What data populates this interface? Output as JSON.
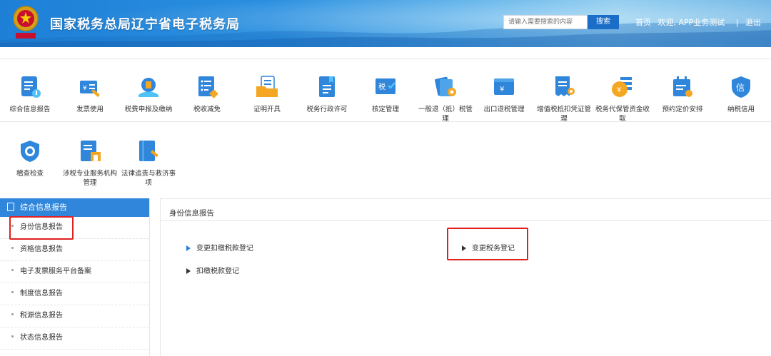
{
  "header": {
    "title": "国家税务总局辽宁省电子税务局",
    "search_placeholder": "请输入需要搜索的内容",
    "search_button": "搜索",
    "home": "首页",
    "welcome": "欢迎, APP业务测试",
    "separator": "|",
    "logout": "退出"
  },
  "menu": {
    "row1": [
      {
        "label": "综合信息报告",
        "icon": "report-icon"
      },
      {
        "label": "发票使用",
        "icon": "invoice-icon"
      },
      {
        "label": "税费申报及缴纳",
        "icon": "tax-declare-icon"
      },
      {
        "label": "税收减免",
        "icon": "tax-relief-icon"
      },
      {
        "label": "证明开具",
        "icon": "certificate-icon"
      },
      {
        "label": "税务行政许可",
        "icon": "permit-icon"
      },
      {
        "label": "核定管理",
        "icon": "approval-icon"
      },
      {
        "label": "一般退（抵）税管理",
        "icon": "refund-icon"
      },
      {
        "label": "出口退税管理",
        "icon": "export-refund-icon"
      },
      {
        "label": "增值税抵扣凭证管理",
        "icon": "vat-voucher-icon"
      },
      {
        "label": "税务代保管资金收取",
        "icon": "custody-fund-icon"
      },
      {
        "label": "预约定价安排",
        "icon": "pricing-calendar-icon"
      },
      {
        "label": "纳税信用",
        "icon": "credit-shield-icon"
      }
    ],
    "row2": [
      {
        "label": "稽查检查",
        "icon": "inspection-shield-icon"
      },
      {
        "label": "涉税专业服务机构管理",
        "icon": "agency-icon"
      },
      {
        "label": "法律追责与救济事项",
        "icon": "law-book-icon"
      }
    ]
  },
  "sidebar": {
    "header": "综合信息报告",
    "items": [
      {
        "label": "身份信息报告"
      },
      {
        "label": "资格信息报告"
      },
      {
        "label": "电子发票服务平台备案"
      },
      {
        "label": "制度信息报告"
      },
      {
        "label": "税源信息报告"
      },
      {
        "label": "状态信息报告"
      }
    ]
  },
  "content": {
    "title": "身份信息报告",
    "links": [
      {
        "label": "变更扣缴税款登记"
      },
      {
        "label": "扣缴税款登记"
      },
      {
        "label": "变更税务登记"
      }
    ]
  },
  "colors": {
    "primary": "#2f86db",
    "highlight": "#e02020"
  }
}
